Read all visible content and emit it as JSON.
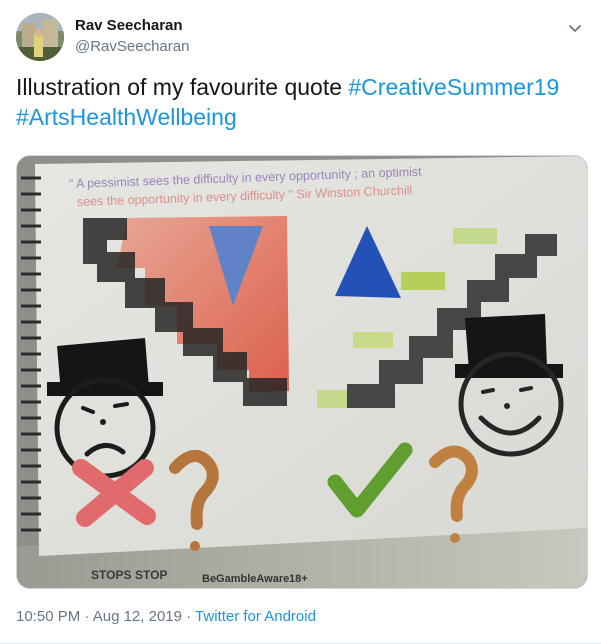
{
  "author": {
    "name": "Rav Seecharan",
    "handle": "@RavSeecharan"
  },
  "tweet": {
    "text": "Illustration of my favourite quote ",
    "hashtag1": "#CreativeSummer19",
    "hashtag2": "#ArtsHealthWellbeing"
  },
  "artwork": {
    "quote_line1": "\" A pessimist sees the difficulty in every opportunity ; an optimist",
    "quote_line2": "sees the opportunity in every difficulty \" Sir Winston Churchill",
    "newspaper": {
      "stops": "STOPS",
      "stop": "STOP",
      "begamble": "BeGambleAware",
      "age": "18+"
    }
  },
  "footer": {
    "time": "10:50 PM",
    "separator": " · ",
    "date": "Aug 12, 2019",
    "source": "Twitter for Android"
  },
  "colors": {
    "link": "#1b95e0",
    "secondary_text": "#657786",
    "primary_text": "#14171a"
  }
}
